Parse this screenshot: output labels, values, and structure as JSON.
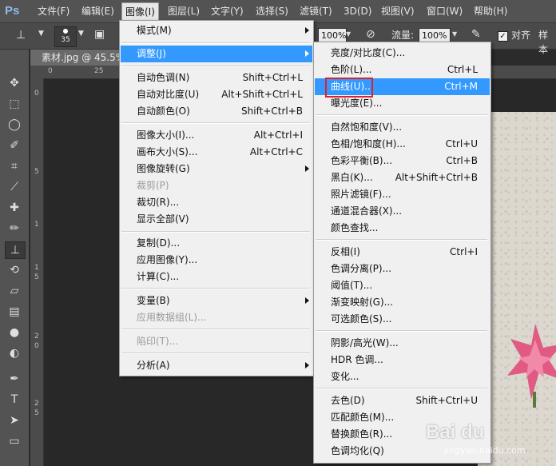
{
  "app_logo": "Ps",
  "menubar": [
    "文件(F)",
    "编辑(E)",
    "图像(I)",
    "图层(L)",
    "文字(Y)",
    "选择(S)",
    "滤镜(T)",
    "3D(D)",
    "视图(V)",
    "窗口(W)",
    "帮助(H)"
  ],
  "options_bar": {
    "brush_size": "35",
    "opacity_value": "100%",
    "flow_label": "流量:",
    "flow_value": "100%",
    "align_label": "对齐",
    "sample_label": "样本"
  },
  "document": {
    "tab_label": "素材.jpg @ 45.5%",
    "ruler_h": [
      "0",
      "25"
    ],
    "ruler_v": [
      "0",
      "5",
      "1",
      "1",
      "5",
      "2",
      "0",
      "2",
      "5"
    ]
  },
  "image_menu": {
    "items": [
      {
        "label": "模式(M)",
        "shortcut": "",
        "submenu": true,
        "disabled": false
      },
      {
        "label": "调整(J)",
        "shortcut": "",
        "submenu": true,
        "disabled": false,
        "highlighted": true
      },
      {
        "label": "自动色调(N)",
        "shortcut": "Shift+Ctrl+L"
      },
      {
        "label": "自动对比度(U)",
        "shortcut": "Alt+Shift+Ctrl+L"
      },
      {
        "label": "自动颜色(O)",
        "shortcut": "Shift+Ctrl+B"
      },
      {
        "label": "图像大小(I)...",
        "shortcut": "Alt+Ctrl+I"
      },
      {
        "label": "画布大小(S)...",
        "shortcut": "Alt+Ctrl+C"
      },
      {
        "label": "图像旋转(G)",
        "shortcut": "",
        "submenu": true
      },
      {
        "label": "裁剪(P)",
        "shortcut": "",
        "disabled": true
      },
      {
        "label": "裁切(R)...",
        "shortcut": ""
      },
      {
        "label": "显示全部(V)",
        "shortcut": ""
      },
      {
        "label": "复制(D)...",
        "shortcut": ""
      },
      {
        "label": "应用图像(Y)...",
        "shortcut": ""
      },
      {
        "label": "计算(C)...",
        "shortcut": ""
      },
      {
        "label": "变量(B)",
        "shortcut": "",
        "submenu": true
      },
      {
        "label": "应用数据组(L)...",
        "shortcut": "",
        "disabled": true
      },
      {
        "label": "陷印(T)...",
        "shortcut": "",
        "disabled": true
      },
      {
        "label": "分析(A)",
        "shortcut": "",
        "submenu": true
      }
    ]
  },
  "adjust_menu": {
    "items": [
      {
        "label": "亮度/对比度(C)...",
        "shortcut": ""
      },
      {
        "label": "色阶(L)...",
        "shortcut": "Ctrl+L"
      },
      {
        "label": "曲线(U)...",
        "shortcut": "Ctrl+M",
        "highlighted": true
      },
      {
        "label": "曝光度(E)...",
        "shortcut": ""
      },
      {
        "label": "自然饱和度(V)...",
        "shortcut": ""
      },
      {
        "label": "色相/饱和度(H)...",
        "shortcut": "Ctrl+U"
      },
      {
        "label": "色彩平衡(B)...",
        "shortcut": "Ctrl+B"
      },
      {
        "label": "黑白(K)...",
        "shortcut": "Alt+Shift+Ctrl+B"
      },
      {
        "label": "照片滤镜(F)...",
        "shortcut": ""
      },
      {
        "label": "通道混合器(X)...",
        "shortcut": ""
      },
      {
        "label": "颜色查找...",
        "shortcut": ""
      },
      {
        "label": "反相(I)",
        "shortcut": "Ctrl+I"
      },
      {
        "label": "色调分离(P)...",
        "shortcut": ""
      },
      {
        "label": "阈值(T)...",
        "shortcut": ""
      },
      {
        "label": "渐变映射(G)...",
        "shortcut": ""
      },
      {
        "label": "可选颜色(S)...",
        "shortcut": ""
      },
      {
        "label": "阴影/高光(W)...",
        "shortcut": ""
      },
      {
        "label": "HDR 色调...",
        "shortcut": ""
      },
      {
        "label": "变化...",
        "shortcut": ""
      },
      {
        "label": "去色(D)",
        "shortcut": "Shift+Ctrl+U"
      },
      {
        "label": "匹配颜色(M)...",
        "shortcut": ""
      },
      {
        "label": "替换颜色(R)...",
        "shortcut": ""
      },
      {
        "label": "色调均化(Q)",
        "shortcut": ""
      }
    ]
  },
  "watermark": {
    "text": "Bai du",
    "sub": "jingyan.baidu.com"
  },
  "colors": {
    "highlight": "#3399ff",
    "menu_bg": "#f0f0f0",
    "red_box": "#e0202a"
  }
}
